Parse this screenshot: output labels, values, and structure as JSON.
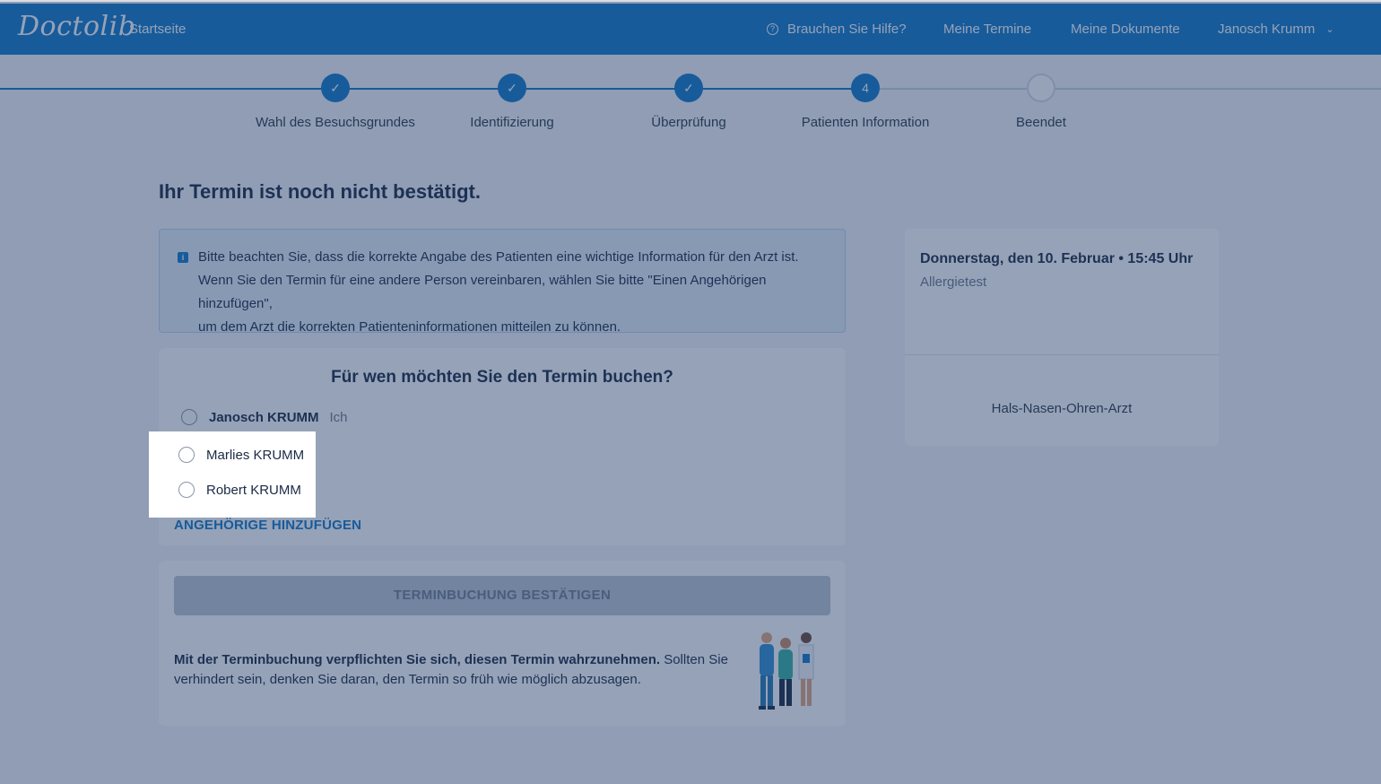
{
  "header": {
    "logo": "Doctolib",
    "home": "Startseite",
    "help": "Brauchen Sie Hilfe?",
    "appointments": "Meine Termine",
    "documents": "Meine Dokumente",
    "user": "Janosch Krumm"
  },
  "stepper": {
    "steps": [
      {
        "label": "Wahl des Besuchsgrundes",
        "marker": "✓",
        "state": "done"
      },
      {
        "label": "Identifizierung",
        "marker": "✓",
        "state": "done"
      },
      {
        "label": "Überprüfung",
        "marker": "✓",
        "state": "done"
      },
      {
        "label": "Patienten Information",
        "marker": "4",
        "state": "current"
      },
      {
        "label": "Beendet",
        "marker": "",
        "state": "todo"
      }
    ]
  },
  "main": {
    "title": "Ihr Termin ist noch nicht bestätigt.",
    "info_lines": [
      "Bitte beachten Sie, dass die korrekte Angabe des Patienten eine wichtige Information für den Arzt ist.",
      "Wenn Sie den Termin für eine andere Person vereinbaren, wählen Sie bitte \"Einen Angehörigen hinzufügen\",",
      "um dem Arzt die korrekten Patienteninformationen mitteilen zu können."
    ],
    "who_title": "Für wen möchten Sie den Termin buchen?",
    "patients": [
      {
        "name": "Janosch KRUMM",
        "tag": "Ich"
      },
      {
        "name": "Marlies KRUMM",
        "tag": ""
      },
      {
        "name": "Robert KRUMM",
        "tag": ""
      }
    ],
    "add_relative": "ANGEHÖRIGE HINZUFÜGEN",
    "confirm_button": "TERMINBUCHUNG BESTÄTIGEN",
    "commitment_bold": "Mit der Terminbuchung verpflichten Sie sich, diesen Termin wahrzunehmen.",
    "commitment_rest": " Sollten Sie verhindert sein, denken Sie daran, den Termin so früh wie möglich abzusagen."
  },
  "sidebar": {
    "date": "Donnerstag, den 10. Februar • 15:45 Uhr",
    "reason": "Allergietest",
    "specialty": "Hals-Nasen-Ohren-Arzt"
  },
  "colors": {
    "brand": "#107acb",
    "overlay": "rgba(31,58,102,0.47)"
  }
}
